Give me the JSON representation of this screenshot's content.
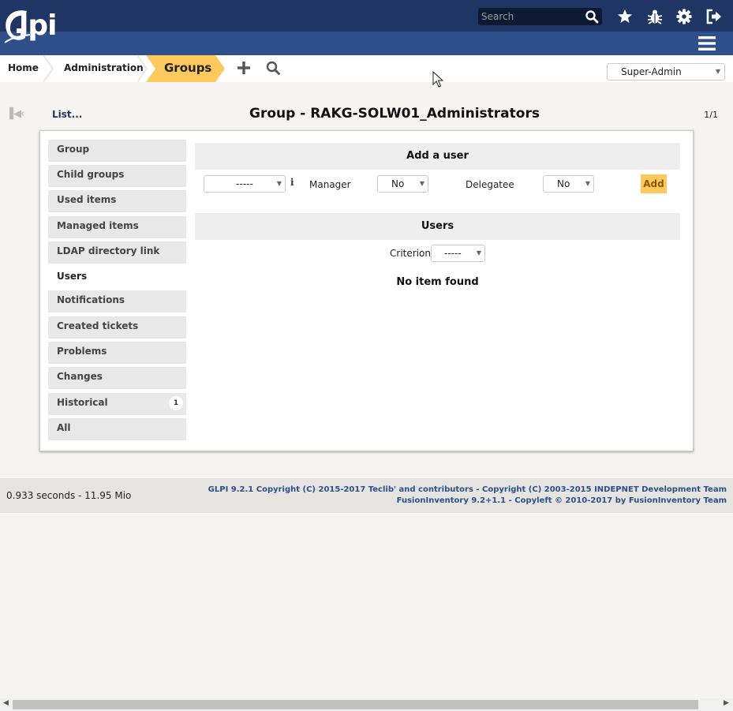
{
  "header": {
    "logo_text": "lpi",
    "search_placeholder": "Search",
    "icons": [
      "star-icon",
      "bug-icon",
      "gear-icon",
      "logout-icon",
      "menu-icon"
    ]
  },
  "breadcrumb": {
    "home": "Home",
    "administration": "Administration",
    "groups": "Groups"
  },
  "profile": {
    "selected": "Super-Admin"
  },
  "navigation": {
    "list_link": "List...",
    "title": "Group - RAKG-SOLW01_Administrators",
    "page_count": "1/1"
  },
  "tabs": [
    {
      "label": "Group"
    },
    {
      "label": "Child groups"
    },
    {
      "label": "Used items"
    },
    {
      "label": "Managed items"
    },
    {
      "label": "LDAP directory link"
    },
    {
      "label": "Users",
      "active": true
    },
    {
      "label": "Notifications"
    },
    {
      "label": "Created tickets"
    },
    {
      "label": "Problems"
    },
    {
      "label": "Changes"
    },
    {
      "label": "Historical",
      "badge": "1"
    },
    {
      "label": "All"
    }
  ],
  "add_user": {
    "heading": "Add a user",
    "user_select": "-----",
    "manager_label": "Manager",
    "manager_value": "No",
    "delegatee_label": "Delegatee",
    "delegatee_value": "No",
    "add_button": "Add"
  },
  "users": {
    "heading": "Users",
    "criterion_label": "Criterion",
    "criterion_value": "-----",
    "empty_message": "No item found"
  },
  "footer": {
    "timing": "0.933 seconds - 11.95 Mio",
    "copyright_glpi": "GLPI 9.2.1 Copyright (C) 2015-2017 Teclib' and contributors - Copyright (C) 2003-2015 INDEPNET Development Team",
    "copyright_fusion": "FusionInventory 9.2+1.1 - Copyleft © 2010-2017 by FusionInventory Team"
  },
  "colors": {
    "header_dark": "#1f3664",
    "header_light": "#2d4f8a",
    "accent_yellow": "#fec95c"
  }
}
